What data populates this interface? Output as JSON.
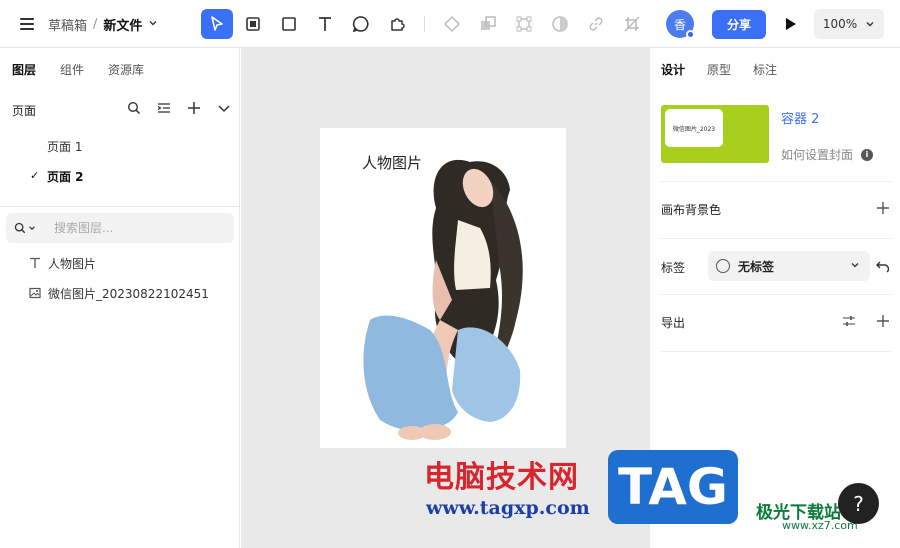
{
  "header": {
    "breadcrumb_folder": "草稿箱",
    "breadcrumb_sep": "/",
    "file_name": "新文件",
    "avatar_initial": "香",
    "share_label": "分享",
    "zoom_level": "100%"
  },
  "toolbar": {
    "tools": [
      "select-tool",
      "frame-tool",
      "rectangle-tool",
      "text-tool",
      "shape-tool",
      "plugin-tool",
      "component-tool",
      "boolean-tool",
      "scale-tool",
      "mask-tool",
      "link-tool",
      "crop-tool"
    ],
    "accent": "#3b6ff5"
  },
  "left_panel": {
    "tabs": [
      {
        "label": "图层",
        "active": true
      },
      {
        "label": "组件",
        "active": false
      },
      {
        "label": "资源库",
        "active": false
      }
    ],
    "pages_title": "页面",
    "pages": [
      {
        "label": "页面 1",
        "current": false
      },
      {
        "label": "页面 2",
        "current": true
      }
    ],
    "current_mark": "✓",
    "search_placeholder": "搜索图层...",
    "layers": [
      {
        "label": "人物图片",
        "icon": "text-icon"
      },
      {
        "label": "微信图片_20230822102451",
        "icon": "image-icon"
      }
    ]
  },
  "canvas": {
    "artboard_text": "人物图片",
    "background": "#e9e9e9"
  },
  "right_panel": {
    "tabs": [
      {
        "label": "设计",
        "active": true
      },
      {
        "label": "原型",
        "active": false
      },
      {
        "label": "标注",
        "active": false
      }
    ],
    "thumbnail_text": "微信图片_2023",
    "container_name": "容器 2",
    "cover_help": "如何设置封面",
    "canvas_bg_label": "画布背景色",
    "tag_label": "标签",
    "tag_value": "无标签",
    "export_label": "导出",
    "thumbnail_color": "#a8cf1e"
  },
  "watermark": {
    "site_cn": "电脑技术网",
    "site_url": "www.tagxp.com",
    "tag_text": "TAG",
    "site2_cn": "极光下载站",
    "site2_url": "www.xz7.com"
  },
  "help_label": "?"
}
